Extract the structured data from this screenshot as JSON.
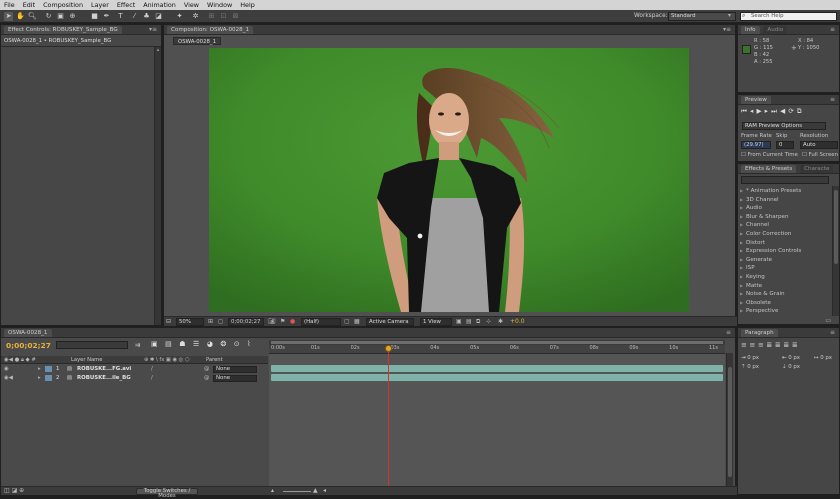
{
  "menu": [
    "File",
    "Edit",
    "Composition",
    "Layer",
    "Effect",
    "Animation",
    "View",
    "Window",
    "Help"
  ],
  "toolbar": {
    "workspace_label": "Workspace:",
    "workspace_value": "Standard",
    "search_placeholder": "Search Help"
  },
  "effect_controls": {
    "tab": "Effect Controls: ROBUSKEY_Sample_BG",
    "subtitle": "OSWA-0028_1 • ROBUSKEY_Sample_BG"
  },
  "composition": {
    "tab": "Composition: OSWA-0028_1",
    "comp_tab": "OSWA-0028_1",
    "zoom": "50%",
    "timecode": "0;00;02;27",
    "resolution": "(Half)",
    "camera": "Active Camera",
    "views": "1 View",
    "exposure": "+0.0"
  },
  "info": {
    "tab_info": "Info",
    "tab_audio": "Audio",
    "r": "R : 58",
    "g": "G : 115",
    "b": "B : 42",
    "a": "A : 255",
    "x": "X : 84",
    "y": "Y : 1050",
    "swatch_color": "#3a732a"
  },
  "preview": {
    "tab": "Preview",
    "options": "RAM Preview Options",
    "frame_rate_label": "Frame Rate",
    "skip_label": "Skip",
    "resolution_label": "Resolution",
    "frame_rate_value": "(29.97)",
    "skip_value": "0",
    "resolution_value": "Auto",
    "from_current": "From Current Time",
    "full_screen": "Full Screen"
  },
  "effects_presets": {
    "tab": "Effects & Presets",
    "tab_character": "Characte",
    "items": [
      "* Animation Presets",
      "3D Channel",
      "Audio",
      "Blur & Sharpen",
      "Channel",
      "Color Correction",
      "Distort",
      "Expression Controls",
      "Generate",
      "ISP",
      "Keying",
      "Matte",
      "Noise & Grain",
      "Obsolete",
      "Perspective"
    ]
  },
  "timeline": {
    "tab": "OSWA-0028_1",
    "timecode": "0;00;02;27",
    "search_placeholder": "",
    "col_layer_name": "Layer Name",
    "col_parent": "Parent",
    "ruler": [
      "0:00s",
      "01s",
      "02s",
      "03s",
      "04s",
      "05s",
      "06s",
      "07s",
      "08s",
      "09s",
      "10s",
      "11s"
    ],
    "layers": [
      {
        "num": "1",
        "name": "ROBUSKE...FG.avi",
        "parent": "None"
      },
      {
        "num": "2",
        "name": "ROBUSKE...ile_BG",
        "parent": "None"
      }
    ],
    "toggle_label": "Toggle Switches / Modes",
    "playhead_fraction": 0.26,
    "work_bar_color": "#7fb2a8",
    "playhead_color": "#d63030"
  },
  "paragraph": {
    "tab": "Paragraph",
    "px1": "0 px",
    "px2": "0 px",
    "px3": "0 px",
    "px4": "0 px",
    "px5": "0 px"
  }
}
